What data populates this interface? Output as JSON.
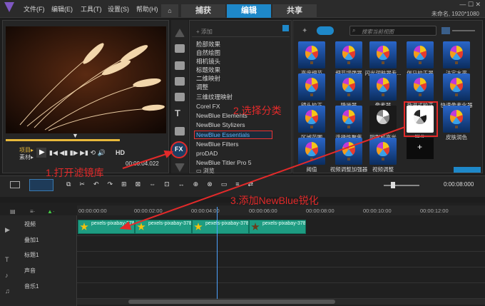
{
  "menubar": {
    "items": [
      "文件(F)",
      "编辑(E)",
      "工具(T)",
      "设置(S)",
      "帮助(H)"
    ]
  },
  "tabs": {
    "home": "⌂",
    "capture": "捕获",
    "edit": "编辑",
    "share": "共享"
  },
  "project_info": "未命名, 1920*1080",
  "preview": {
    "mode_labels": [
      "项目▸",
      "素材▸"
    ],
    "hd_label": "HD",
    "timecode": "00:00:04.022"
  },
  "library": {
    "add_label": "添加",
    "browse_label": "浏览",
    "fx_label": "FX",
    "categories": [
      "脸部效果",
      "自然绘图",
      "相机镜头",
      "标题效果",
      "二维映射",
      "调整",
      "三维纹理映射",
      "Corel FX",
      "NewBlue Elements",
      "NewBlue Stylizers",
      "NewBlue Essentials",
      "NewBlue Filters",
      "proDAD",
      "NewBlue Titler Pro 5"
    ],
    "selected_category": "NewBlue Essentials"
  },
  "gallery": {
    "search_placeholder": "搜索当前视图",
    "items": [
      "亮度细节",
      "细节增强器",
      "闪光润肤器专...",
      "伽马校正器",
      "法定水平",
      "镜头校正",
      "降噪器",
      "像素器",
      "渐进式校正",
      "快速像素化器",
      "区域范围",
      "选择性聚焦",
      "阴影和高光",
      "锐化",
      "皮肤润色",
      "阈值",
      "视频调整加强器",
      "视频调整"
    ],
    "add_label": "+",
    "selected_item": "锐化"
  },
  "timeline": {
    "toolbar_timecode": "0:00:08:000",
    "ruler": [
      "00:00:00:00",
      "00:00:02:00",
      "00:00:04:00",
      "00:00:06:00",
      "00:00:08:00",
      "00:00:10:00",
      "00:00:12:00"
    ],
    "tracks": [
      "视频",
      "叠加1",
      "标题1",
      "声音",
      "音乐1"
    ],
    "clips": [
      "pexels-pixabay-3783",
      "pexels-pixabay-3783",
      "pexels-pixabay-3783",
      "pexels-pixabay-3783"
    ]
  },
  "annotations": {
    "step1": "1.打开滤镜库",
    "step2": "2.选择分类",
    "step3": "3.添加NewBlue锐化"
  },
  "colors": {
    "accent": "#1e88c9",
    "annotation": "#e32a2a",
    "clip": "#1e9c82"
  }
}
